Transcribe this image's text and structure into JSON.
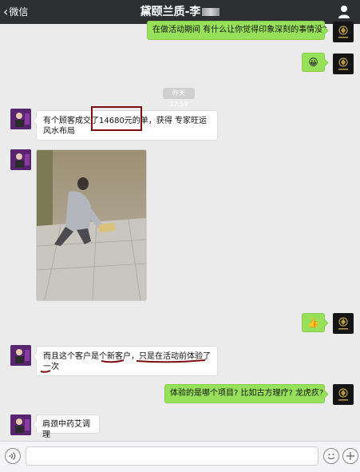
{
  "header": {
    "back_label": "微信",
    "title": "黛颐兰质-李"
  },
  "messages": {
    "m1": "在做活动期间 有什么让你觉得印象深刻的事情没?",
    "m2_emoji": "😀",
    "timestamp": "昨天 17:59",
    "m3_part1": "有个顾客成交了",
    "m3_highlight": "14680元的单",
    "m3_part2": "，获得 专家旺运风水布局",
    "m5_thumb": "👍",
    "m6_a": "而且这个客户是个",
    "m6_b": "新客户",
    "m6_c": "，只是",
    "m6_d": "在活动前体验了一次",
    "m7": "体验的是哪个项目? 比如古方理疗? 龙虎疚?",
    "m8": "肩颈中药艾调理"
  },
  "colors": {
    "right_bubble": "#97e05a",
    "header_bg": "#2d2f33",
    "annotation": "#7a0c12"
  },
  "icons": {
    "back": "chevron-left-icon",
    "profile": "person-icon",
    "voice": "voice-icon",
    "emoji": "smiley-icon",
    "plus": "plus-icon"
  }
}
